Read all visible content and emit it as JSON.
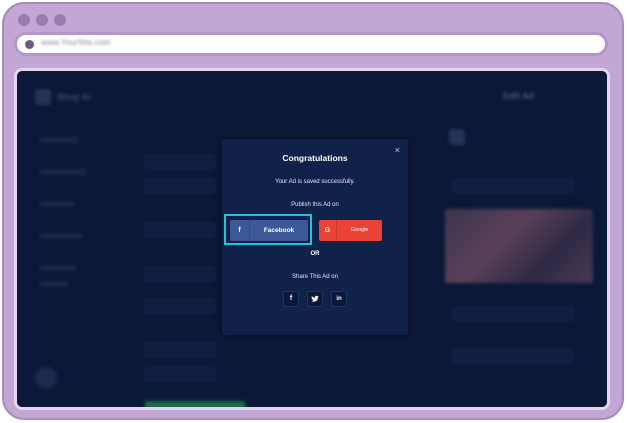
{
  "browser": {
    "url": "www.YourSite.com"
  },
  "background_app": {
    "brand": "Shop Ai",
    "page_title": "Edit Ad"
  },
  "modal": {
    "title": "Congratulations",
    "message": "Your Ad is saved successfully.",
    "publish_label": "Publish this Ad on",
    "facebook_label": "Facebook",
    "facebook_icon": "f",
    "google_label": "Google",
    "google_icon": "G",
    "or_label": "OR",
    "share_label": "Share This Ad on",
    "close_icon": "×",
    "share_icons": {
      "facebook": "f",
      "twitter": "t",
      "linkedin": "in"
    }
  },
  "colors": {
    "frame": "#c2a6d4",
    "screen_bg": "#0b1838",
    "modal_bg": "#11224a",
    "facebook": "#3b5998",
    "google": "#ea4335",
    "highlight": "#27c2d6"
  }
}
